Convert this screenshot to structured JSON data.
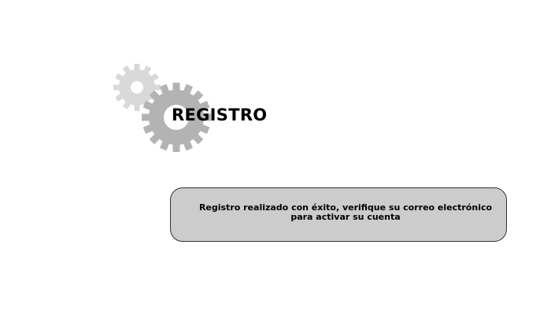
{
  "page": {
    "title": "REGISTRO"
  },
  "icons": {
    "small_gear": "gear-icon",
    "large_gear": "gear-icon",
    "small_gear_color": "#d9d9d9",
    "large_gear_color": "#b3b3b3"
  },
  "message": {
    "text": "Registro realizado con éxito, verifique su correo electrónico\npara activar su cuenta",
    "background_color": "#cccccc",
    "border_color": "#333333"
  }
}
